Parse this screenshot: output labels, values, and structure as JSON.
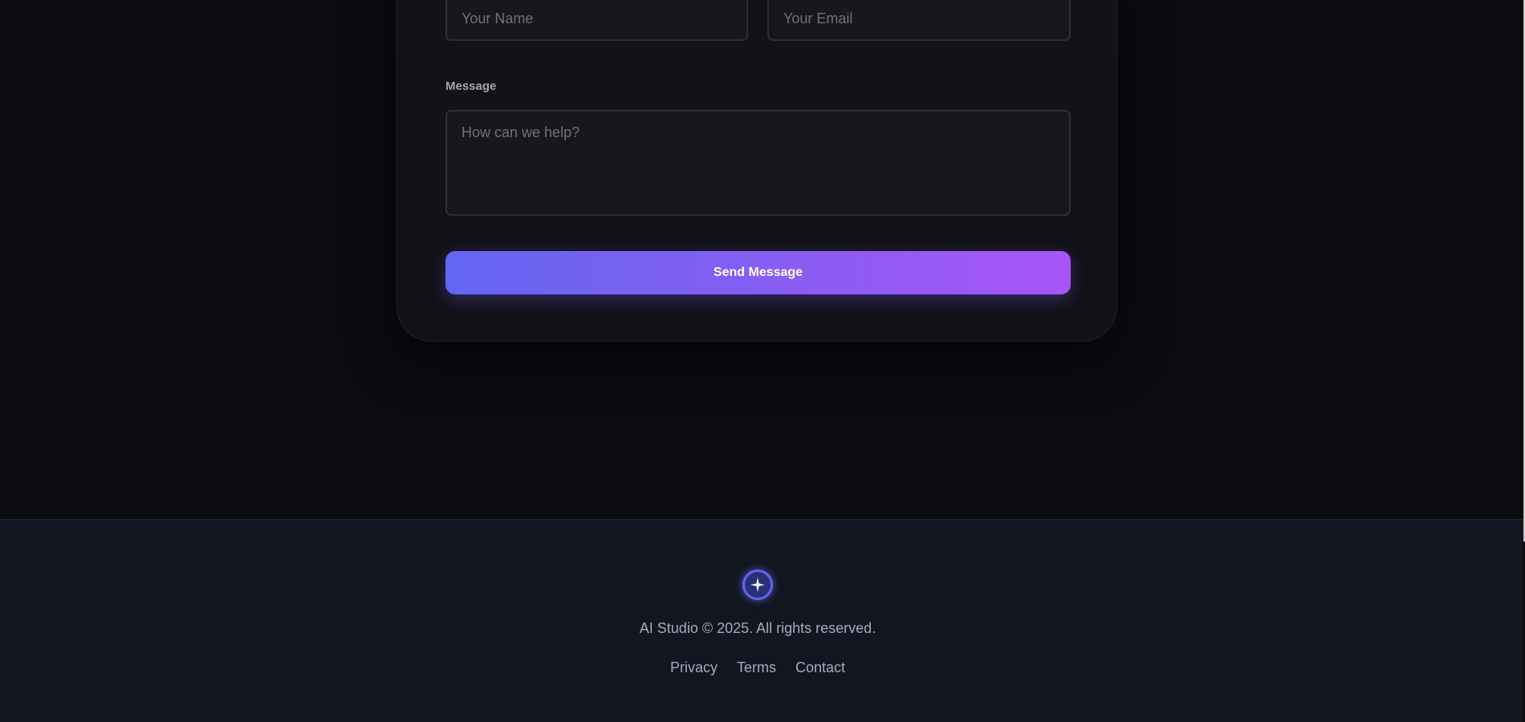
{
  "contact_form": {
    "name_placeholder": "Your Name",
    "email_placeholder": "Your Email",
    "message_label": "Message",
    "message_placeholder": "How can we help?",
    "send_label": "Send Message"
  },
  "footer": {
    "logo_icon": "sparkle-icon",
    "copyright": "AI Studio © 2025. All rights reserved.",
    "links": [
      "Privacy",
      "Terms",
      "Contact"
    ]
  },
  "colors": {
    "accent_start": "#6366f1",
    "accent_end": "#a855f7",
    "background": "#0b0b10",
    "footer_background": "#111620"
  }
}
